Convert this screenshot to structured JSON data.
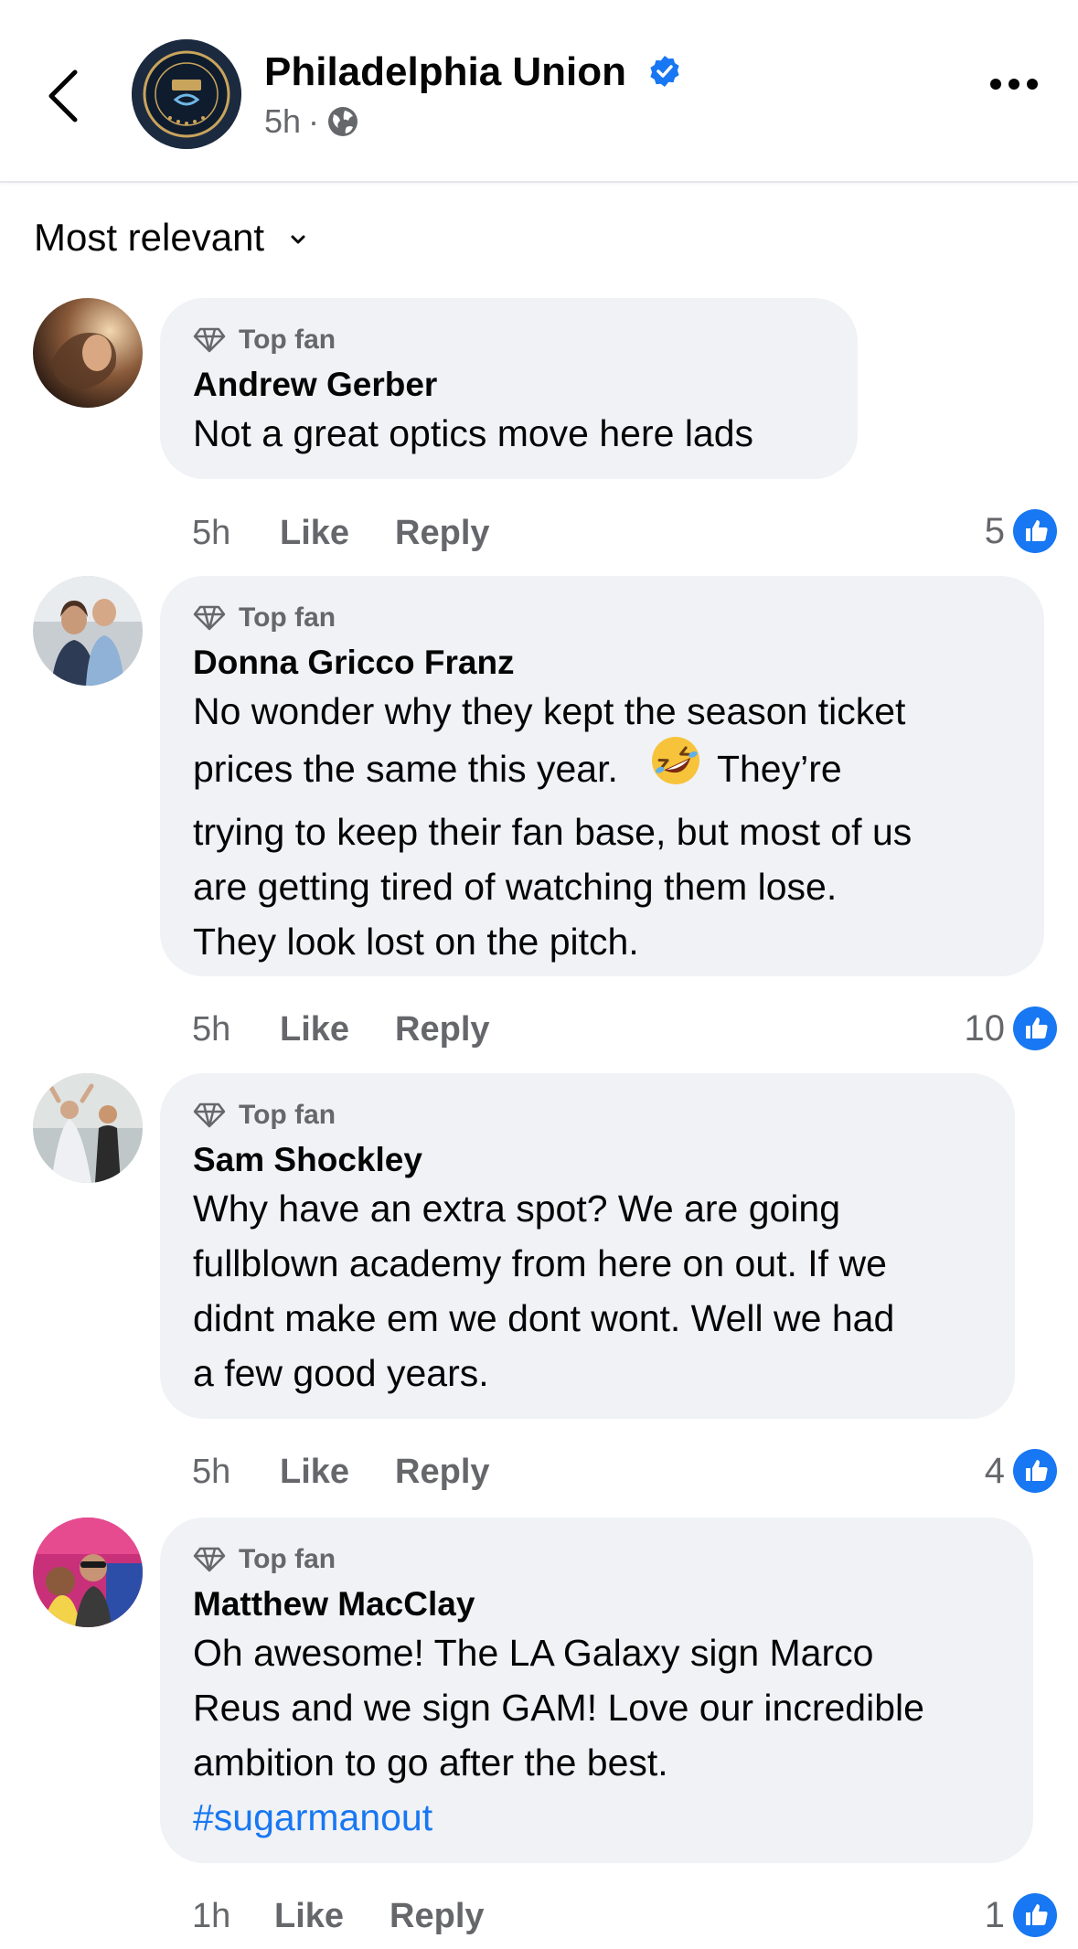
{
  "header": {
    "page_name": "Philadelphia Union",
    "post_time": "5h",
    "separator": "·",
    "verified_icon": "verified-badge-icon",
    "privacy_icon": "globe-icon"
  },
  "sort": {
    "label": "Most relevant"
  },
  "colors": {
    "accent": "#1877f2",
    "bubble": "#f0f2f5",
    "muted": "#65676b",
    "text": "#050505"
  },
  "comments": [
    {
      "badge": "Top fan",
      "author": "Andrew Gerber",
      "lines": [
        "Not a great optics move here lads"
      ],
      "time": "5h",
      "like_label": "Like",
      "reply_label": "Reply",
      "reaction_count": "5"
    },
    {
      "badge": "Top fan",
      "author": "Donna Gricco Franz",
      "lines": [
        "No wonder why they kept the season ticket",
        "prices the same this year.",
        "They’re",
        "trying to keep their fan base, but most of us",
        "are getting tired of watching them lose.",
        "They look lost on the pitch."
      ],
      "emoji": "🤣",
      "time": "5h",
      "like_label": "Like",
      "reply_label": "Reply",
      "reaction_count": "10"
    },
    {
      "badge": "Top fan",
      "author": "Sam Shockley",
      "lines": [
        "Why have an extra spot? We are going",
        "fullblown academy from here on out. If we",
        "didnt make em we dont wont. Well we had",
        "a few good years."
      ],
      "time": "5h",
      "like_label": "Like",
      "reply_label": "Reply",
      "reaction_count": "4"
    },
    {
      "badge": "Top fan",
      "author": "Matthew MacClay",
      "lines": [
        "Oh awesome! The LA Galaxy sign Marco",
        "Reus and we sign GAM! Love our incredible",
        "ambition to go after the best."
      ],
      "hashtag": "#sugarmanout",
      "time": "1h",
      "like_label": "Like",
      "reply_label": "Reply",
      "reaction_count": "1"
    }
  ]
}
